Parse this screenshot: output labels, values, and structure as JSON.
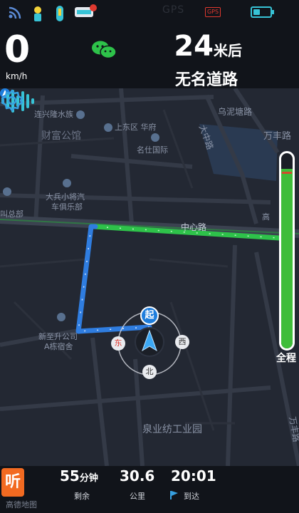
{
  "status": {
    "ghost_text": "GPS",
    "gps_label": "GPS",
    "battery_level": 0.4,
    "icons": [
      "wifi-icon",
      "hotspot-icon",
      "car-link-icon",
      "notification-icon",
      "gps-icon",
      "battery-icon"
    ]
  },
  "header": {
    "speed_value": "0",
    "speed_unit": "km/h",
    "distance_value": "24",
    "distance_unit": "米后",
    "road_name": "无名道路"
  },
  "map": {
    "pois": [
      "连兴隆水族",
      "上东区 华府",
      "名仕国际",
      "大兵小将汽",
      "车俱乐部",
      "新至升公司",
      "A栋宿舍"
    ],
    "poi_partial": [
      "财富公馆",
      "乌泥塘路",
      "万丰路",
      "大中路",
      "叫总部",
      "高"
    ],
    "road_labels": [
      "中心路",
      "泉业纺工业园",
      "万丰路"
    ],
    "start_badge": "起",
    "compass_east": "西",
    "compass_south": "北",
    "compass_west": "东",
    "route_progress": 0.92,
    "progress_label": "全程"
  },
  "footer": {
    "listen_label": "听",
    "remaining_time_value": "55",
    "remaining_time_unit": "分钟",
    "remaining_time_label": "剩余",
    "distance_value": "30.6",
    "distance_label": "公里",
    "arrival_time": "20:01",
    "arrival_label": "到达",
    "brand": "高德地图"
  },
  "colors": {
    "route_blue": "#2f7de0",
    "route_green": "#2ec24a",
    "accent_orange": "#f26a21",
    "battery_cyan": "#37c3d6"
  }
}
